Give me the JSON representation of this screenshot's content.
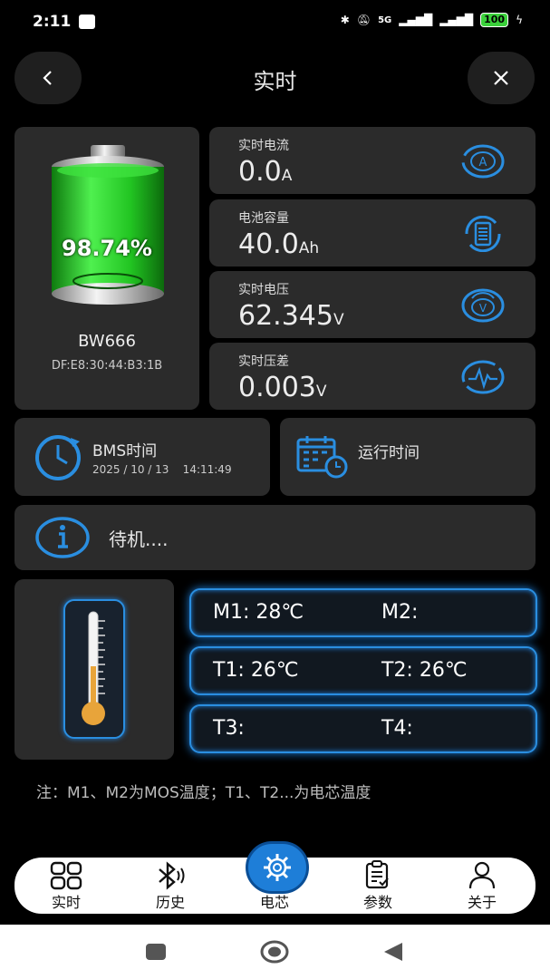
{
  "status": {
    "time": "2:11",
    "network": "5G",
    "battery": "100"
  },
  "header": {
    "title": "实时"
  },
  "battery": {
    "percent": "98.74%",
    "name": "BW666",
    "mac": "DF:E8:30:44:B3:1B",
    "level": 0.9874
  },
  "metrics": [
    {
      "label": "实时电流",
      "value": "0.0",
      "unit": "A",
      "icon": "ampere-icon"
    },
    {
      "label": "电池容量",
      "value": "40.0",
      "unit": "Ah",
      "icon": "battery-capacity-icon"
    },
    {
      "label": "实时电压",
      "value": "62.345",
      "unit": "V",
      "icon": "voltage-icon"
    },
    {
      "label": "实时压差",
      "value": "0.003",
      "unit": "V",
      "icon": "voltage-difference-icon"
    }
  ],
  "bms": {
    "label": "BMS时间",
    "datetime": "2025 / 10 / 13    14:11:49"
  },
  "runtime": {
    "label": "运行时间"
  },
  "state": {
    "text": "待机...."
  },
  "temps": {
    "m1": "M1: 28℃",
    "m2": "M2:",
    "t1": "T1: 26℃",
    "t2": "T2: 26℃",
    "t3": "T3:",
    "t4": "T4:"
  },
  "note": "注：M1、M2为MOS温度；T1、T2...为电芯温度",
  "nav": [
    {
      "label": "实时",
      "icon": "grid-icon"
    },
    {
      "label": "历史",
      "icon": "bluetooth-icon"
    },
    {
      "label": "电芯",
      "icon": "gear-icon"
    },
    {
      "label": "参数",
      "icon": "clipboard-icon"
    },
    {
      "label": "关于",
      "icon": "user-icon"
    }
  ],
  "colors": {
    "accent": "#2a8ee0",
    "card": "#2b2b2b",
    "battery_green": "#2fd12f"
  }
}
